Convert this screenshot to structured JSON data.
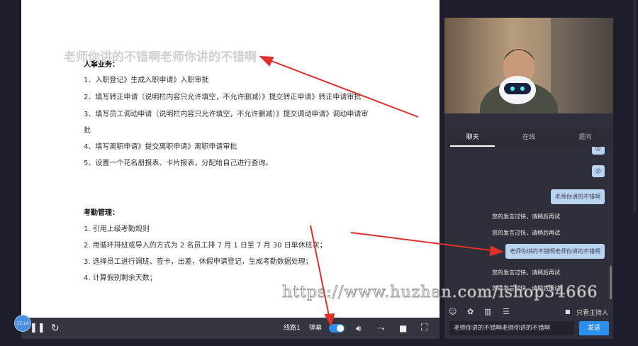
{
  "document": {
    "danmaku": "老师你讲的不错啊老师你讲的不错啊",
    "section1_title": "人事业务：",
    "section1_items": [
      "1、入职登记》生成入职申请》入职审批",
      "2、填写转正申请（说明栏内容只允许填空，不允许删减）》提交转正申请》转正申请审批",
      "3、填写员工调动申请（说明栏内容只允许填空，不允许删减）》提交调动申请》调动申请审",
      "批",
      "4、填写离职申请》提交离职申请》离职申请审批",
      "5、设置一个花名册报表、卡片报表，分配给自己进行查询。"
    ],
    "section2_title": "考勤管理：",
    "section2_items": [
      "1.  引用上级考勤规则",
      "2.  用循环排班或导入的方式为 2 名员工排 7 月 1 日至 7 月 30 日单休班次；",
      "3.  选择员工进行调班、签卡，出差，休假申请登记，生成考勤数据处理；",
      "4.  计算假别剩余天数；"
    ]
  },
  "player": {
    "time": "17:14",
    "line": "线路1",
    "danmaku_label": "弹幕",
    "danmaku_on": true
  },
  "chat": {
    "tabs": [
      "聊天",
      "在线",
      "提问"
    ],
    "messages": [
      {
        "type": "emoji",
        "text": "😠"
      },
      {
        "type": "emoji",
        "text": "😮"
      },
      {
        "type": "bubble",
        "text": "老师你讲的不错啊"
      },
      {
        "type": "system",
        "text": "您的发言过快，请稍后再试"
      },
      {
        "type": "system",
        "text": "您的发言过快，请稍后再试"
      },
      {
        "type": "bubble",
        "text": "老师你讲的不错啊老师你讲的不错啊"
      },
      {
        "type": "system",
        "text": "您的发言过快，请稍后再试"
      },
      {
        "type": "system",
        "text": "您的发言过快，请稍后再试"
      }
    ],
    "only_host": "只看主持人",
    "input_value": "老师你讲的不错啊老师你讲的不错啊",
    "send": "发送"
  },
  "watermark": "https://www.huzhan.com/ishop34666",
  "colors": {
    "accent": "#2b8ff0",
    "bubble": "#b9d4f1",
    "arrow": "#e0302a"
  }
}
